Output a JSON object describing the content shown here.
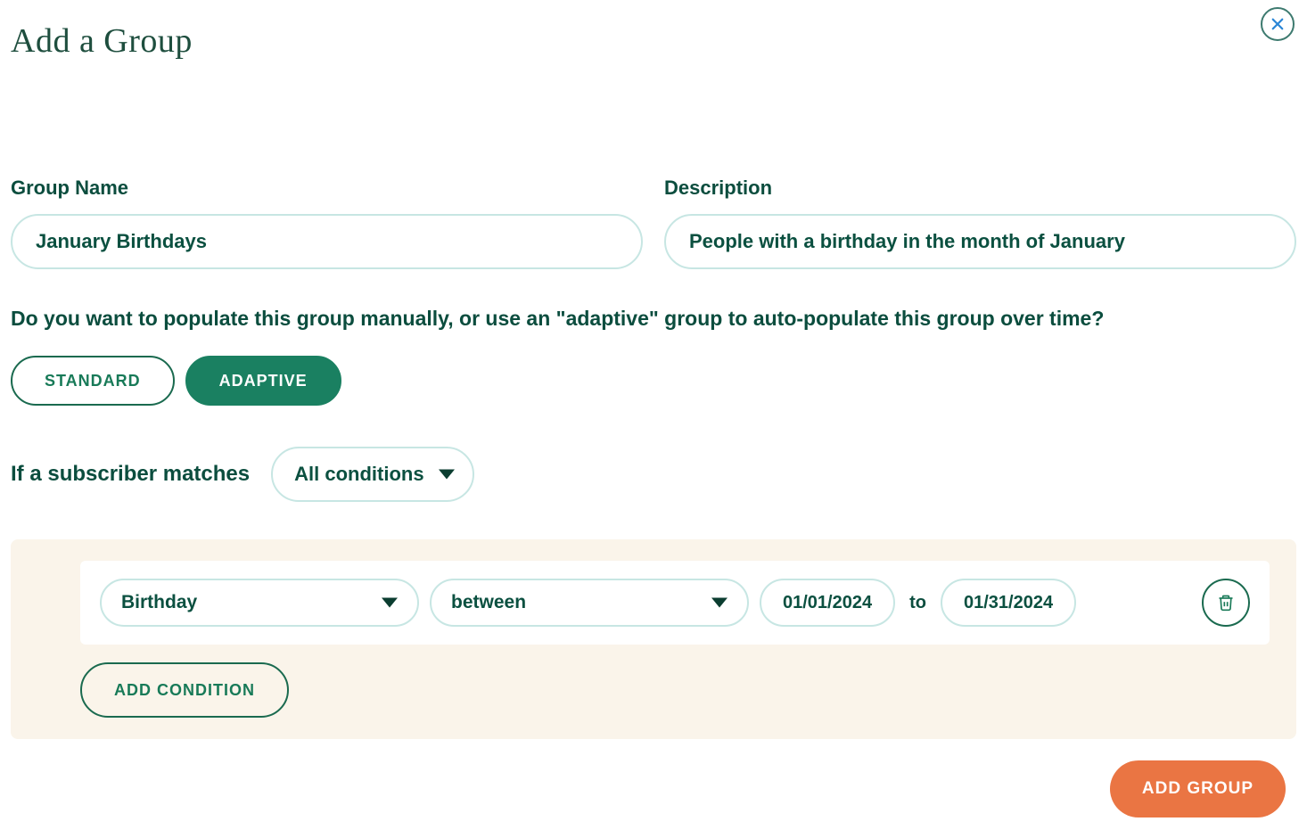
{
  "page_title": "Add a Group",
  "labels": {
    "group_name": "Group Name",
    "description": "Description",
    "question": "Do you want to populate this group manually, or use an \"adaptive\" group to auto-populate this group over time?",
    "match_prefix": "If a subscriber matches",
    "to": "to"
  },
  "inputs": {
    "group_name_value": "January Birthdays",
    "description_value": "People with a birthday in the month of January"
  },
  "group_type": {
    "standard_label": "STANDARD",
    "adaptive_label": "ADAPTIVE",
    "selected": "adaptive"
  },
  "match": {
    "selected": "All conditions"
  },
  "conditions": [
    {
      "field": "Birthday",
      "operator": "between",
      "date_from": "01/01/2024",
      "date_to": "01/31/2024"
    }
  ],
  "buttons": {
    "add_condition": "ADD CONDITION",
    "add_group": "ADD GROUP"
  }
}
